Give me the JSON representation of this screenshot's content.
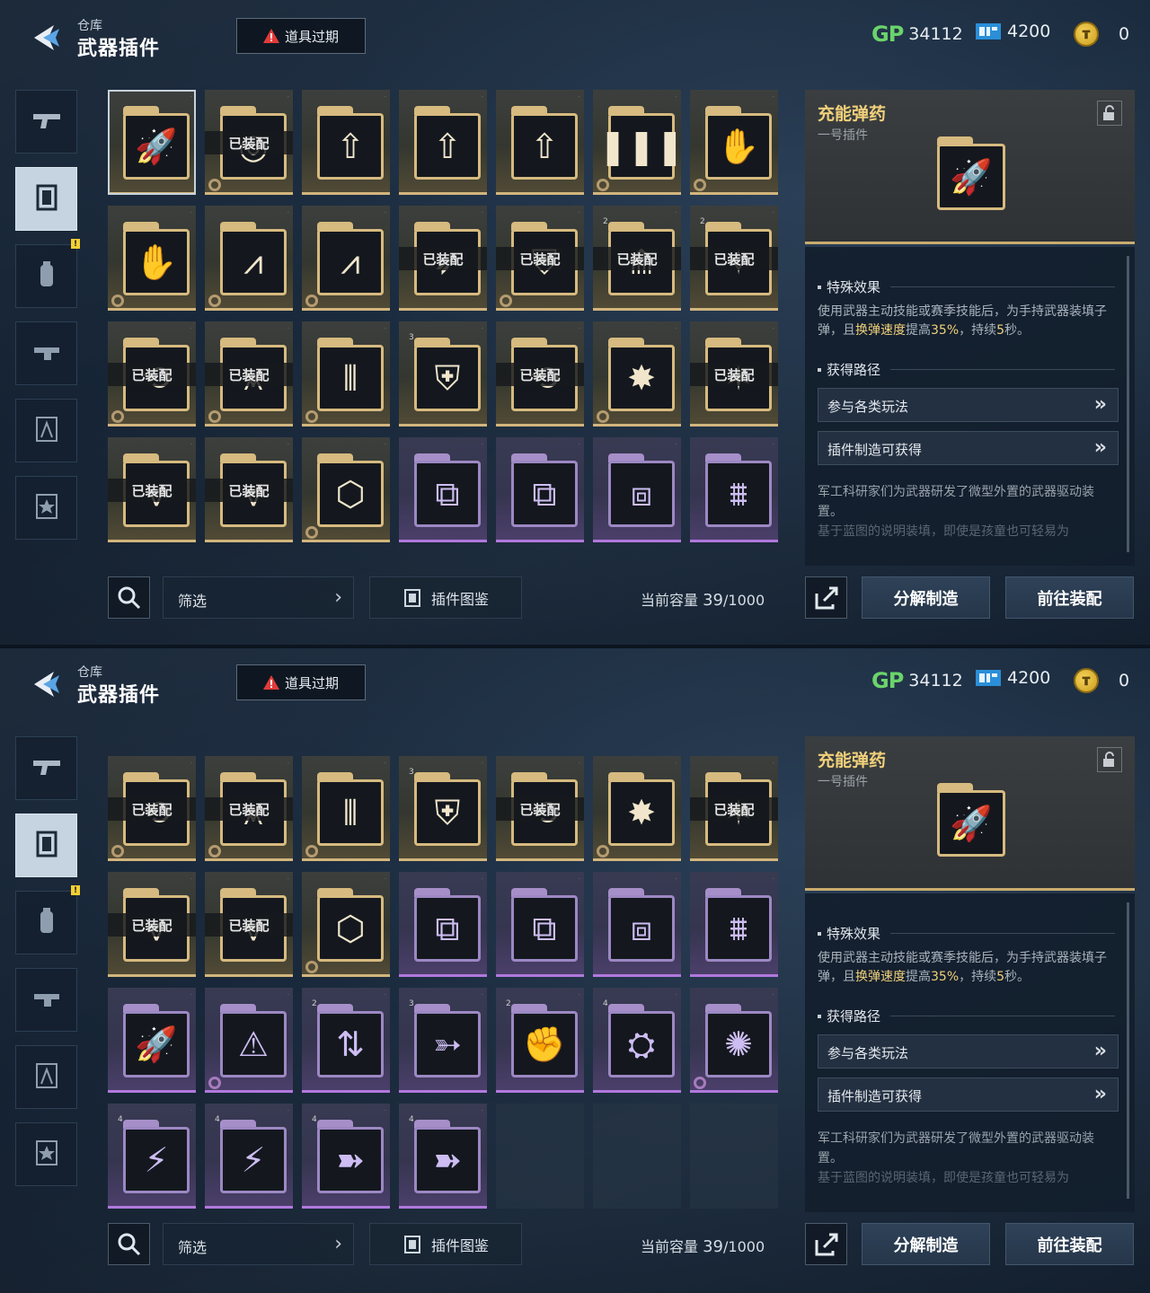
{
  "header": {
    "breadcrumb": "仓库",
    "title": "武器插件",
    "expire_label": "道具过期",
    "currencies": {
      "gp_label": "GP",
      "gp_value": "34112",
      "ticket_value": "4200",
      "coin_value": "0"
    }
  },
  "sidebar": {
    "tabs": [
      {
        "icon": "pistol-icon",
        "active": false
      },
      {
        "icon": "plugin-icon",
        "active": true
      },
      {
        "icon": "grenade-icon",
        "active": false,
        "badge": "!"
      },
      {
        "icon": "attachment-icon",
        "active": false
      },
      {
        "icon": "blueprint-icon",
        "active": false
      },
      {
        "icon": "star-icon",
        "active": false
      }
    ]
  },
  "equipped_label": "已装配",
  "grid_top": [
    {
      "rarity": "gold",
      "glyph": "🚀",
      "selected": true
    },
    {
      "rarity": "gold",
      "glyph": "◎",
      "equipped": true,
      "gear": true
    },
    {
      "rarity": "gold",
      "glyph": "⇧"
    },
    {
      "rarity": "gold",
      "glyph": "⇧"
    },
    {
      "rarity": "gold",
      "glyph": "⇧"
    },
    {
      "rarity": "gold",
      "glyph": "❚❚❚",
      "gear": true
    },
    {
      "rarity": "gold",
      "glyph": "✋",
      "gear": true
    },
    {
      "rarity": "gold",
      "glyph": "✋",
      "gear": true
    },
    {
      "rarity": "gold",
      "glyph": "⩘",
      "gear": true
    },
    {
      "rarity": "gold",
      "glyph": "⩘",
      "gear": true
    },
    {
      "rarity": "gold",
      "glyph": "➶",
      "equipped": true
    },
    {
      "rarity": "gold",
      "glyph": "⛨",
      "equipped": true,
      "gear": true
    },
    {
      "rarity": "gold",
      "glyph": "⟰",
      "equipped": true,
      "lvl": "2"
    },
    {
      "rarity": "gold",
      "glyph": "✧",
      "equipped": true,
      "lvl": "2"
    },
    {
      "rarity": "gold",
      "glyph": "⟲",
      "equipped": true,
      "gear": true
    },
    {
      "rarity": "gold",
      "glyph": "⩙",
      "equipped": true,
      "gear": true
    },
    {
      "rarity": "gold",
      "glyph": "⦀",
      "gear": true
    },
    {
      "rarity": "gold",
      "glyph": "⛨",
      "lvl": "3"
    },
    {
      "rarity": "gold",
      "glyph": "⟲",
      "equipped": true
    },
    {
      "rarity": "gold",
      "glyph": "✸",
      "gear": true
    },
    {
      "rarity": "gold",
      "glyph": "✶",
      "equipped": true
    },
    {
      "rarity": "gold",
      "glyph": "⩔",
      "equipped": true
    },
    {
      "rarity": "gold",
      "glyph": "⩔",
      "equipped": true
    },
    {
      "rarity": "gold",
      "glyph": "⬡",
      "gear": true
    },
    {
      "rarity": "purple",
      "glyph": "⧉"
    },
    {
      "rarity": "purple",
      "glyph": "⧉"
    },
    {
      "rarity": "purple",
      "glyph": "⧈"
    },
    {
      "rarity": "purple",
      "glyph": "⩩"
    }
  ],
  "grid_bottom": [
    {
      "rarity": "gold",
      "glyph": "⟲",
      "equipped": true,
      "gear": true
    },
    {
      "rarity": "gold",
      "glyph": "⩙",
      "equipped": true,
      "gear": true
    },
    {
      "rarity": "gold",
      "glyph": "⦀",
      "gear": true
    },
    {
      "rarity": "gold",
      "glyph": "⛨",
      "lvl": "3"
    },
    {
      "rarity": "gold",
      "glyph": "⟲",
      "equipped": true
    },
    {
      "rarity": "gold",
      "glyph": "✸",
      "gear": true
    },
    {
      "rarity": "gold",
      "glyph": "✶",
      "equipped": true
    },
    {
      "rarity": "gold",
      "glyph": "⩔",
      "equipped": true
    },
    {
      "rarity": "gold",
      "glyph": "⩔",
      "equipped": true
    },
    {
      "rarity": "gold",
      "glyph": "⬡",
      "gear": true
    },
    {
      "rarity": "purple",
      "glyph": "⧉"
    },
    {
      "rarity": "purple",
      "glyph": "⧉"
    },
    {
      "rarity": "purple",
      "glyph": "⧈"
    },
    {
      "rarity": "purple",
      "glyph": "⩩"
    },
    {
      "rarity": "purple",
      "glyph": "🚀"
    },
    {
      "rarity": "purple",
      "glyph": "⚠",
      "gear": true
    },
    {
      "rarity": "purple",
      "glyph": "⇅",
      "lvl": "2"
    },
    {
      "rarity": "purple",
      "glyph": "➳",
      "lvl": "3"
    },
    {
      "rarity": "purple",
      "glyph": "✊",
      "lvl": "2"
    },
    {
      "rarity": "purple",
      "glyph": "⛭",
      "lvl": "4"
    },
    {
      "rarity": "purple",
      "glyph": "✺",
      "gear": true
    },
    {
      "rarity": "purple",
      "glyph": "⚡",
      "lvl": "4"
    },
    {
      "rarity": "purple",
      "glyph": "⚡",
      "lvl": "4"
    },
    {
      "rarity": "purple",
      "glyph": "➽",
      "lvl": "4"
    },
    {
      "rarity": "purple",
      "glyph": "➽",
      "lvl": "4"
    },
    {
      "rarity": "empty"
    },
    {
      "rarity": "empty"
    },
    {
      "rarity": "empty"
    }
  ],
  "toolbar": {
    "filter_label": "筛选",
    "codex_label": "插件图鉴",
    "capacity_label": "当前容量",
    "capacity_used": "39",
    "capacity_total": "/1000"
  },
  "detail": {
    "name": "充能弹药",
    "slot": "一号插件",
    "glyph": "🚀",
    "effect_heading": "特殊效果",
    "effect_pre": "使用武器主动技能或赛季技能后，为手持武器装填子弹，且",
    "effect_hl1": "换弹速度",
    "effect_mid": "提高",
    "effect_hl2": "35%",
    "effect_mid2": "，持续",
    "effect_hl3": "5",
    "effect_post": "秒。",
    "route_heading": "获得路径",
    "routes": [
      "参与各类玩法",
      "插件制造可获得"
    ],
    "flavor_1": "军工科研家们为武器研发了微型外置的武器驱动装置。",
    "flavor_2": "基于蓝图的说明装填，即使是孩童也可轻易为"
  },
  "actions": {
    "decompose_label": "分解制造",
    "equip_label": "前往装配"
  },
  "colors": {
    "gold_accent": "#d6ba7f",
    "purple_accent": "#b178dd",
    "highlight_text": "#f0d07a",
    "gp_green": "#6bd36b"
  }
}
